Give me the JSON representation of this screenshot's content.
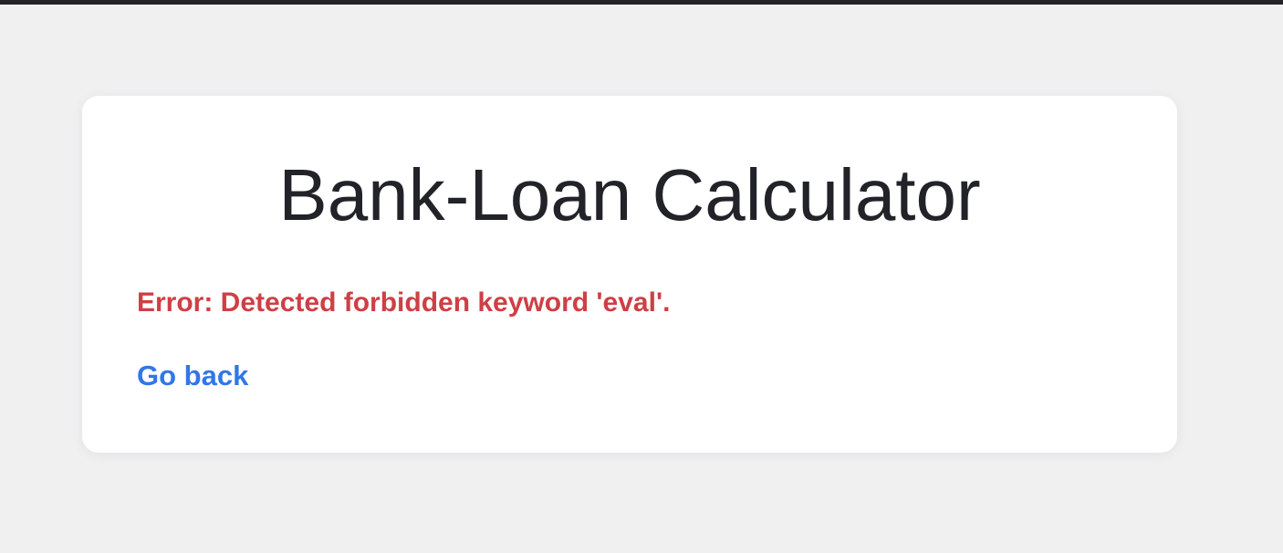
{
  "page": {
    "title": "Bank-Loan Calculator",
    "error_message": "Error: Detected forbidden keyword 'eval'.",
    "back_link_label": "Go back"
  },
  "colors": {
    "background": "#f0f0f1",
    "top_bar": "#232428",
    "card": "#ffffff",
    "title_text": "#212328",
    "error_text": "#cf3f45",
    "link_text": "#3276e8"
  }
}
